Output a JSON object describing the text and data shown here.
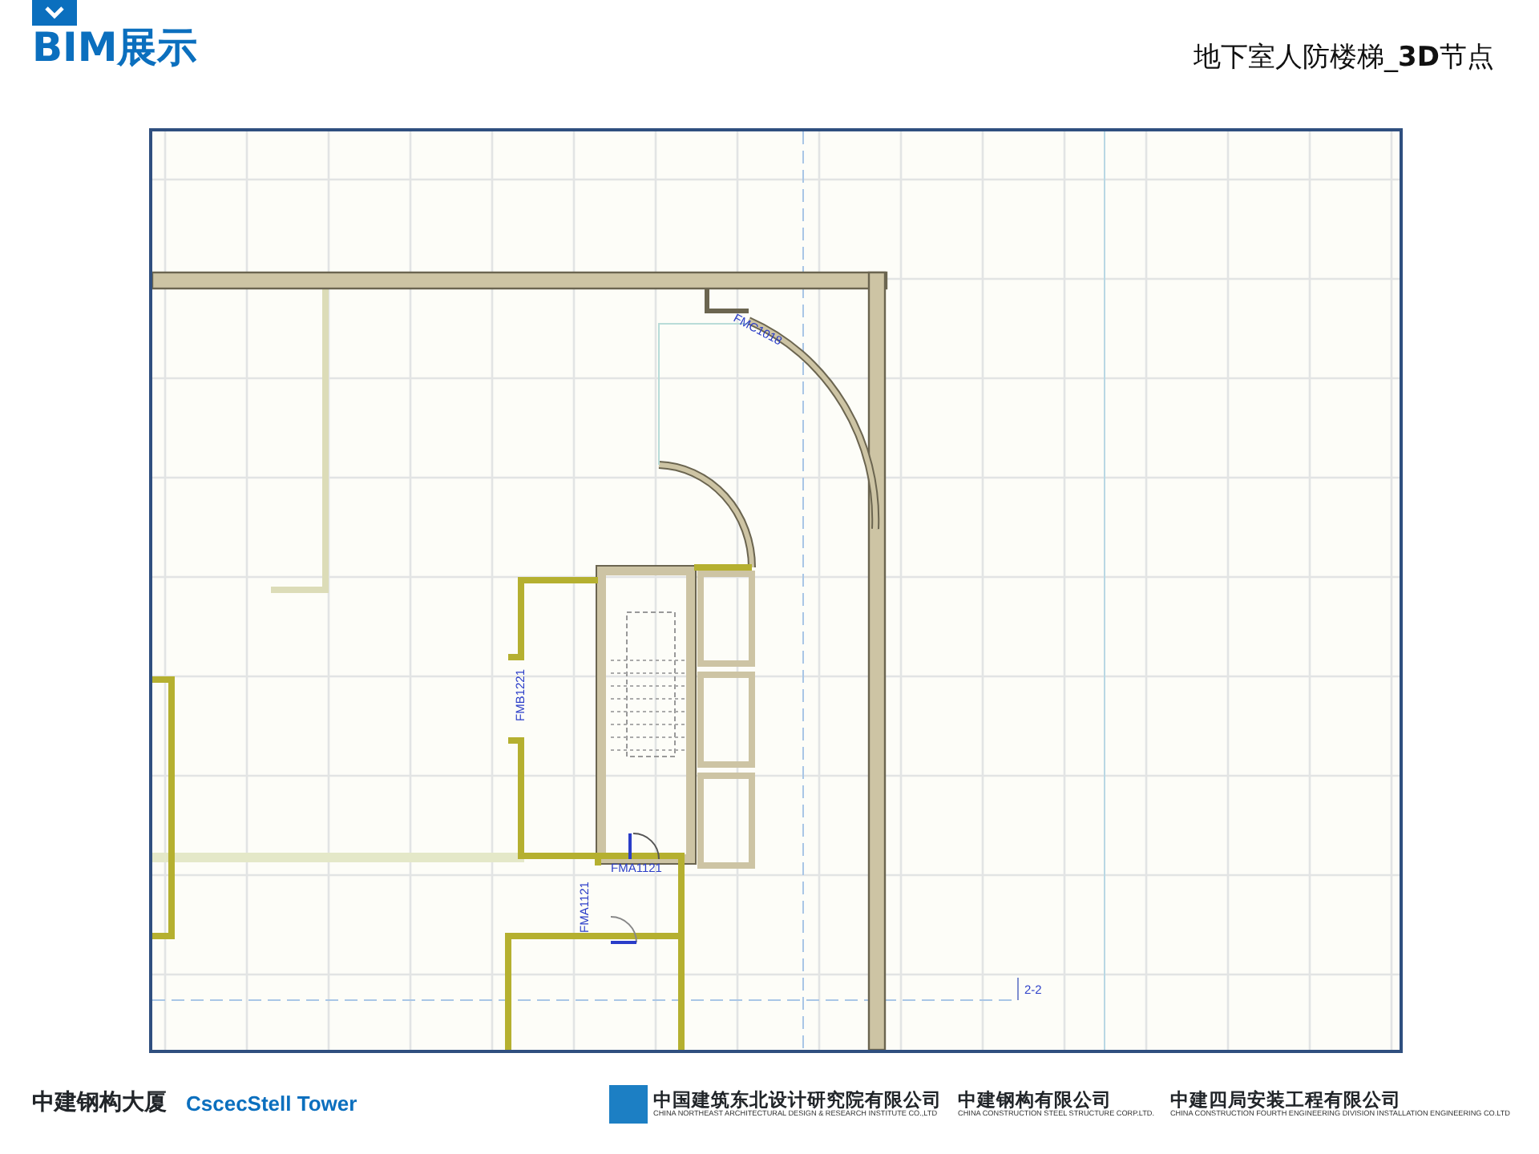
{
  "header": {
    "title": "BIM展示",
    "subtitle": "地下室人防楼梯_**3D**节点"
  },
  "plan": {
    "labels": [
      "FMC1018",
      "FMB1221",
      "FMA1121",
      "FMA1121",
      "2-2"
    ]
  },
  "footer": {
    "project_cn": "中建钢构大厦",
    "project_en": "CscecStell Tower",
    "companies": [
      {
        "name": "中国建筑东北设计研究院有限公司",
        "name_en": "CHINA NORTHEAST ARCHITECTURAL DESIGN & RESEARCH INSTITUTE CO.,LTD",
        "logo": true
      },
      {
        "name": "中建钢构有限公司",
        "name_en": "CHINA CONSTRUCTION STEEL STRUCTURE CORP.LTD.",
        "logo": false
      },
      {
        "name": "中建四局安装工程有限公司",
        "name_en": "CHINA CONSTRUCTION FOURTH ENGINEERING DIVISION INSTALLATION ENGINEERING CO.LTD",
        "logo": false
      }
    ]
  }
}
